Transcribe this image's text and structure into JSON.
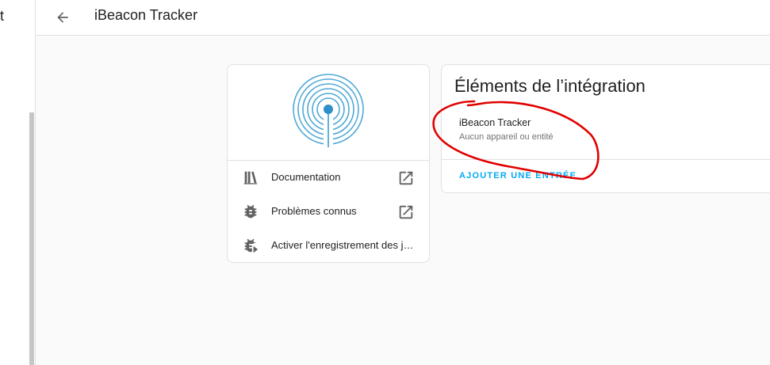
{
  "sidebar": {
    "title_fragment": "t"
  },
  "header": {
    "title": "iBeacon Tracker"
  },
  "info_card": {
    "links": [
      {
        "label": "Documentation",
        "icon": "book-shelf-icon",
        "external": true
      },
      {
        "label": "Problèmes connus",
        "icon": "bug-icon",
        "external": true
      },
      {
        "label": "Activer l'enregistrement des jo...",
        "icon": "bug-play-icon",
        "external": false
      }
    ]
  },
  "entries_card": {
    "title": "Éléments de l’intégration",
    "entries": [
      {
        "name": "iBeacon Tracker",
        "subtitle": "Aucun appareil ou entité"
      }
    ],
    "add_button": "AJOUTER UNE ENTRÉE"
  },
  "colors": {
    "accent": "#03a9f4",
    "logo_blue": "#4fa9d6",
    "annotation_red": "#e00000"
  }
}
